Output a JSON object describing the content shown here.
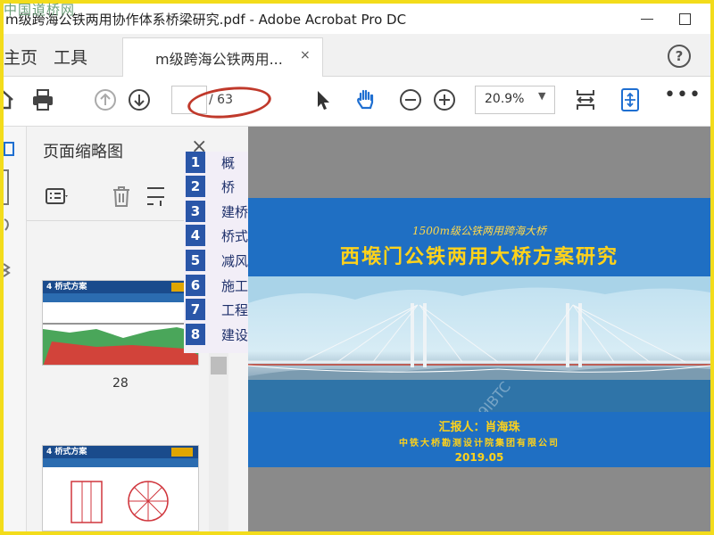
{
  "watermark": {
    "text": "中国道桥网"
  },
  "window": {
    "title": "m级跨海公铁两用协作体系桥梁研究.pdf - Adobe Acrobat Pro DC"
  },
  "tabs": {
    "home": "主页",
    "tools": "工具",
    "document": "m级跨海公铁两用...",
    "close": "×",
    "help": "?"
  },
  "toolbar": {
    "icons": [
      "home-icon",
      "print-icon",
      "prev-page-icon",
      "next-page-icon",
      "select-arrow-icon",
      "hand-icon",
      "zoom-out-icon",
      "zoom-in-icon",
      "fit-page-icon",
      "fit-width-icon",
      "more-icon"
    ],
    "page_current": "",
    "page_total": "/ 63",
    "zoom": "20.9%",
    "more": "•••"
  },
  "sidebar": {
    "title": "页面缩略图",
    "close": "×",
    "thumbnails": [
      {
        "page": "28",
        "heading": "4  桥式方案"
      },
      {
        "page": "",
        "heading": "4  桥式方案"
      }
    ]
  },
  "menu": {
    "items": [
      {
        "num": "1",
        "label": "概　　述"
      },
      {
        "num": "2",
        "label": "桥　　位"
      },
      {
        "num": "3",
        "label": "建桥条件"
      },
      {
        "num": "4",
        "label": "桥式方案"
      },
      {
        "num": "5",
        "label": "减风措施"
      },
      {
        "num": "6",
        "label": "施工组织"
      },
      {
        "num": "7",
        "label": "工程实例"
      },
      {
        "num": "8",
        "label": "建设难度"
      }
    ]
  },
  "slide": {
    "subtitle": "1500m级公铁两用跨海大桥",
    "title": "西堠门公铁两用大桥方案研究",
    "presenter": "汇报人：肖海珠",
    "organization": "中铁大桥勘测设计院集团有限公司",
    "date": "2019.05",
    "watermark": "2019IBTC"
  },
  "colors": {
    "accent": "#2a56a8",
    "slide_text": "#ffd21a",
    "highlight": "#c0392b",
    "frame": "#f3dc1b"
  }
}
